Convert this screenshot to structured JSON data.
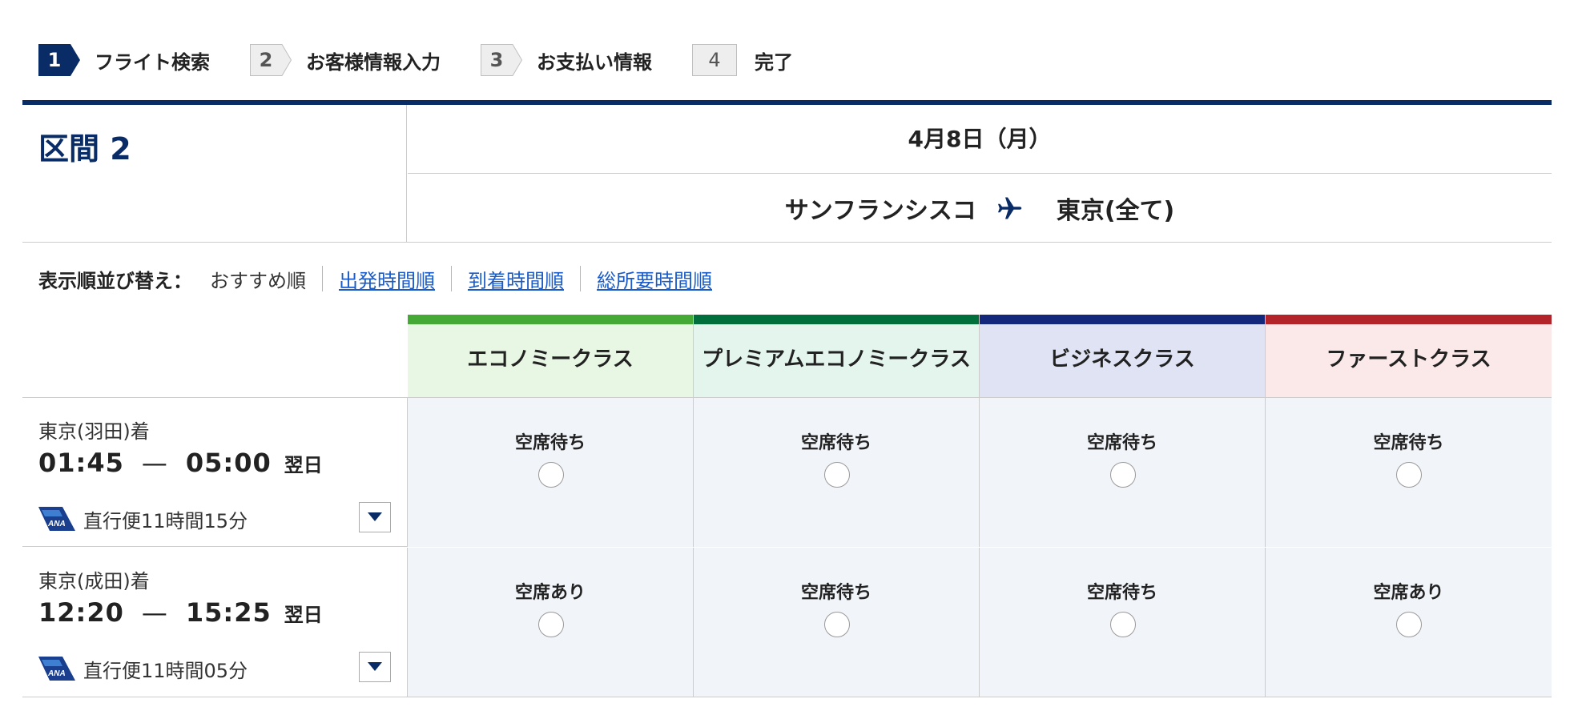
{
  "steps": [
    {
      "num": "1",
      "label": "フライト検索"
    },
    {
      "num": "2",
      "label": "お客様情報入力"
    },
    {
      "num": "3",
      "label": "お支払い情報"
    },
    {
      "num": "4",
      "label": "完了"
    }
  ],
  "section": {
    "title": "区間 2",
    "date": "4月8日（月）",
    "origin": "サンフランシスコ",
    "destination": "東京(全て)"
  },
  "sort": {
    "label": "表示順並び替え：",
    "current": "おすすめ順",
    "options": [
      "出発時間順",
      "到着時間順",
      "総所要時間順"
    ]
  },
  "classes": [
    {
      "name": "エコノミークラス",
      "bar_color": "#45aa35",
      "bg_color": "#e8f6e4"
    },
    {
      "name": "プレミアムエコノミークラス",
      "bar_color": "#006f3c",
      "bg_color": "#e4f5ee"
    },
    {
      "name": "ビジネスクラス",
      "bar_color": "#13287a",
      "bg_color": "#dfe3f4"
    },
    {
      "name": "ファーストクラス",
      "bar_color": "#b3232a",
      "bg_color": "#fbe8e8"
    }
  ],
  "flights": [
    {
      "arrival": "東京(羽田)着",
      "depart": "01:45",
      "arrive": "05:00",
      "next_day": "翌日",
      "duration": "直行便11時間15分",
      "fares": [
        "空席待ち",
        "空席待ち",
        "空席待ち",
        "空席待ち"
      ]
    },
    {
      "arrival": "東京(成田)着",
      "depart": "12:20",
      "arrive": "15:25",
      "next_day": "翌日",
      "duration": "直行便11時間05分",
      "fares": [
        "空席あり",
        "空席待ち",
        "空席待ち",
        "空席あり"
      ]
    }
  ],
  "colors": {
    "brand_navy": "#0a2c66",
    "link": "#1a5bc8",
    "cell_bg": "#f1f4f9"
  }
}
